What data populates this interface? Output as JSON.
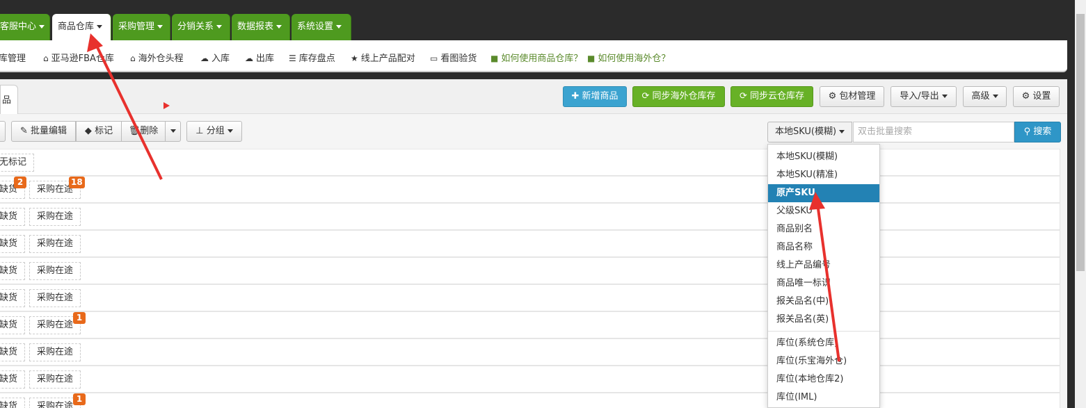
{
  "nav": {
    "tabs": [
      {
        "label": "客服中心"
      },
      {
        "label": "商品仓库"
      },
      {
        "label": "采购管理"
      },
      {
        "label": "分销关系"
      },
      {
        "label": "数据报表"
      },
      {
        "label": "系统设置"
      }
    ]
  },
  "subnav": {
    "items": [
      {
        "label": "库管理",
        "icon": "home-icon"
      },
      {
        "label": "亚马逊FBA仓库",
        "icon": "home-icon"
      },
      {
        "label": "海外仓头程",
        "icon": "home-icon"
      },
      {
        "label": "入库",
        "icon": "cloud-upload-icon"
      },
      {
        "label": "出库",
        "icon": "cloud-download-icon"
      },
      {
        "label": "库存盘点",
        "icon": "list-icon"
      },
      {
        "label": "线上产品配对",
        "icon": "star-icon"
      },
      {
        "label": "看图验货",
        "icon": "monitor-icon"
      },
      {
        "label": "如何使用商品仓库？",
        "icon": "video-icon"
      },
      {
        "label": "如何使用海外仓？",
        "icon": "video-icon"
      }
    ]
  },
  "header": {
    "left_tab": "品",
    "add_product": "新增商品",
    "sync_overseas": "同步海外仓库存",
    "sync_cloud": "同步云仓库存",
    "packaging": "包材管理",
    "import_export": "导入/导出",
    "advanced": "高级",
    "settings": "设置"
  },
  "toolbar": {
    "batch_edit": "批量编辑",
    "mark": "标记",
    "delete": "删除",
    "group": "分组",
    "search_type": "本地SKU(模糊)",
    "search_placeholder": "双击批量搜索",
    "search_button": "搜索"
  },
  "rows": [
    {
      "tags": [
        {
          "label": "无标记"
        }
      ]
    },
    {
      "tags": [
        {
          "label": "缺货",
          "badge": "2"
        },
        {
          "label": "采购在途",
          "badge": "18"
        }
      ]
    },
    {
      "tags": [
        {
          "label": "缺货"
        },
        {
          "label": "采购在途"
        }
      ]
    },
    {
      "tags": [
        {
          "label": "缺货"
        },
        {
          "label": "采购在途"
        }
      ]
    },
    {
      "tags": [
        {
          "label": "缺货"
        },
        {
          "label": "采购在途"
        }
      ]
    },
    {
      "tags": [
        {
          "label": "缺货"
        },
        {
          "label": "采购在途"
        }
      ]
    },
    {
      "tags": [
        {
          "label": "缺货"
        },
        {
          "label": "采购在途",
          "badge": "1"
        }
      ]
    },
    {
      "tags": [
        {
          "label": "缺货"
        },
        {
          "label": "采购在途"
        }
      ]
    },
    {
      "tags": [
        {
          "label": "缺货"
        },
        {
          "label": "采购在途"
        }
      ]
    },
    {
      "tags": [
        {
          "label": "缺货"
        },
        {
          "label": "采购在途",
          "badge": "1"
        }
      ]
    }
  ],
  "dropdown": {
    "items": [
      {
        "label": "本地SKU(模糊)"
      },
      {
        "label": "本地SKU(精准)"
      },
      {
        "label": "原产SKU",
        "selected": true
      },
      {
        "label": "父级SKU"
      },
      {
        "label": "商品别名"
      },
      {
        "label": "商品名称"
      },
      {
        "label": "线上产品编号"
      },
      {
        "label": "商品唯一标识"
      },
      {
        "label": "报关品名(中)"
      },
      {
        "label": "报关品名(英)"
      },
      {
        "label": "库位(系统仓库)"
      },
      {
        "label": "库位(乐宝海外仓)"
      },
      {
        "label": "库位(本地仓库2)"
      },
      {
        "label": "库位(IML)"
      }
    ]
  },
  "colors": {
    "nav_green": "#4e9a1f",
    "btn_blue": "#3ba3d0",
    "btn_green": "#67b126",
    "badge_orange": "#e8691a",
    "selected_blue": "#2382b4",
    "arrow_red": "#e8312d"
  }
}
